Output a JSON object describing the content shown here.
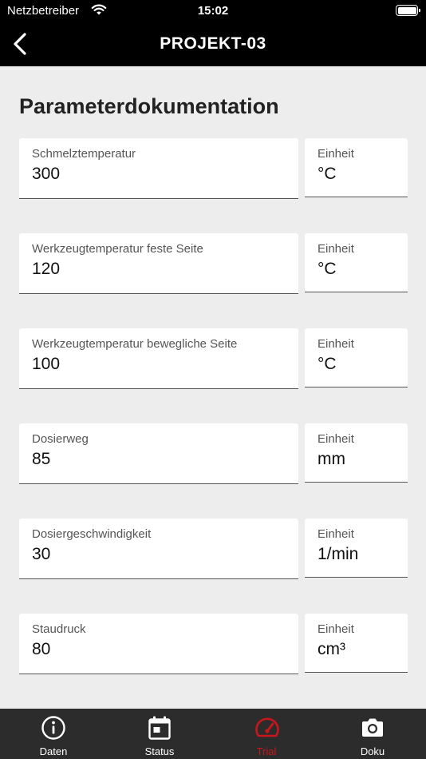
{
  "status_bar": {
    "carrier": "Netzbetreiber",
    "time": "15:02"
  },
  "nav": {
    "title": "PROJEKT-03"
  },
  "section": {
    "title": "Parameterdokumentation"
  },
  "parameters": [
    {
      "label": "Schmelztemperatur",
      "value": "300",
      "unit_label": "Einheit",
      "unit": "°C"
    },
    {
      "label": "Werkzeugtemperatur feste Seite",
      "value": "120",
      "unit_label": "Einheit",
      "unit": "°C"
    },
    {
      "label": "Werkzeugtemperatur bewegliche Seite",
      "value": "100",
      "unit_label": "Einheit",
      "unit": "°C"
    },
    {
      "label": "Dosierweg",
      "value": "85",
      "unit_label": "Einheit",
      "unit": "mm"
    },
    {
      "label": "Dosiergeschwindigkeit",
      "value": "30",
      "unit_label": "Einheit",
      "unit": "1/min"
    },
    {
      "label": "Staudruck",
      "value": "80",
      "unit_label": "Einheit",
      "unit": "cm³"
    }
  ],
  "tabs": [
    {
      "label": "Daten",
      "icon": "info-icon"
    },
    {
      "label": "Status",
      "icon": "calendar-icon"
    },
    {
      "label": "Trial",
      "icon": "speedometer-icon",
      "active": true
    },
    {
      "label": "Doku",
      "icon": "camera-icon"
    }
  ],
  "colors": {
    "accent": "#c8161d",
    "tab_bar": "#2c2c2c",
    "nav_bar": "#000000",
    "background": "#ededed"
  }
}
